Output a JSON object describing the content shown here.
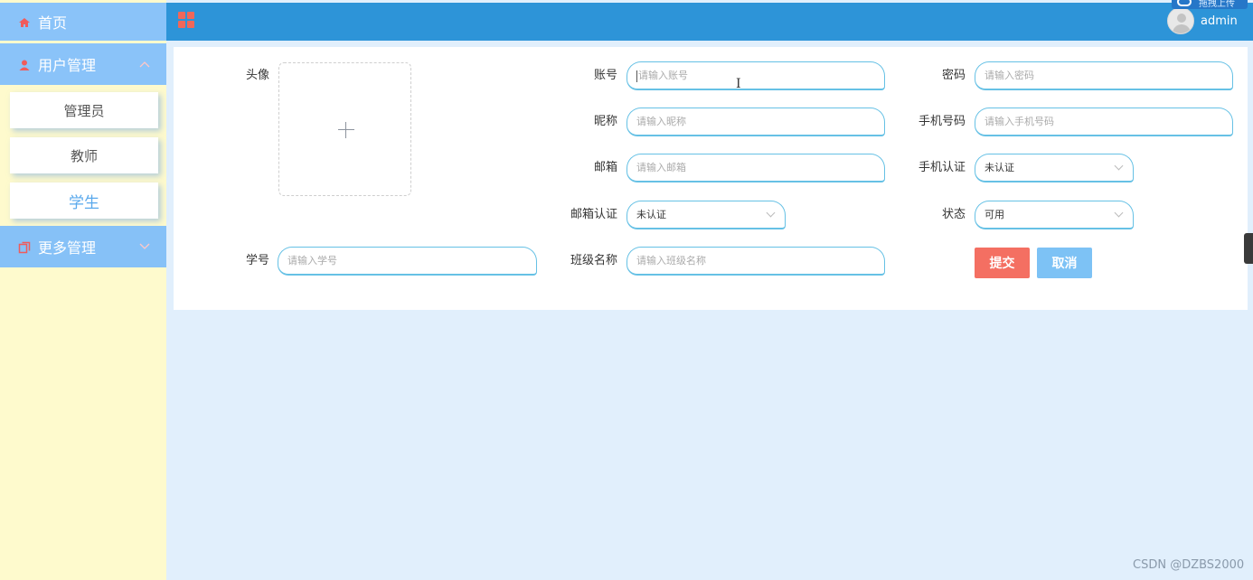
{
  "sidebar": {
    "home": "首页",
    "user_mgmt": "用户管理",
    "sub_items": [
      "管理员",
      "教师",
      "学生"
    ],
    "more_mgmt": "更多管理"
  },
  "header": {
    "user_name": "admin",
    "upload_tag": "拖拽上传"
  },
  "form": {
    "avatar_label": "头像",
    "account": {
      "label": "账号",
      "placeholder": "请输入账号"
    },
    "password": {
      "label": "密码",
      "placeholder": "请输入密码"
    },
    "nickname": {
      "label": "昵称",
      "placeholder": "请输入昵称"
    },
    "phone": {
      "label": "手机号码",
      "placeholder": "请输入手机号码"
    },
    "email": {
      "label": "邮箱",
      "placeholder": "请输入邮箱"
    },
    "phone_verify": {
      "label": "手机认证",
      "value": "未认证"
    },
    "email_verify": {
      "label": "邮箱认证",
      "value": "未认证"
    },
    "status": {
      "label": "状态",
      "value": "可用"
    },
    "student_no": {
      "label": "学号",
      "placeholder": "请输入学号"
    },
    "class_name": {
      "label": "班级名称",
      "placeholder": "请输入班级名称"
    },
    "submit": "提交",
    "cancel": "取消"
  },
  "watermark": "CSDN @DZBS2000",
  "colors": {
    "sidebar_bg": "#fefacd",
    "menu_blue": "#8ac3f9",
    "topbar": "#2d94d8",
    "content_bg": "#e1effc",
    "submit": "#f46f62",
    "cancel": "#7dc2f5"
  }
}
